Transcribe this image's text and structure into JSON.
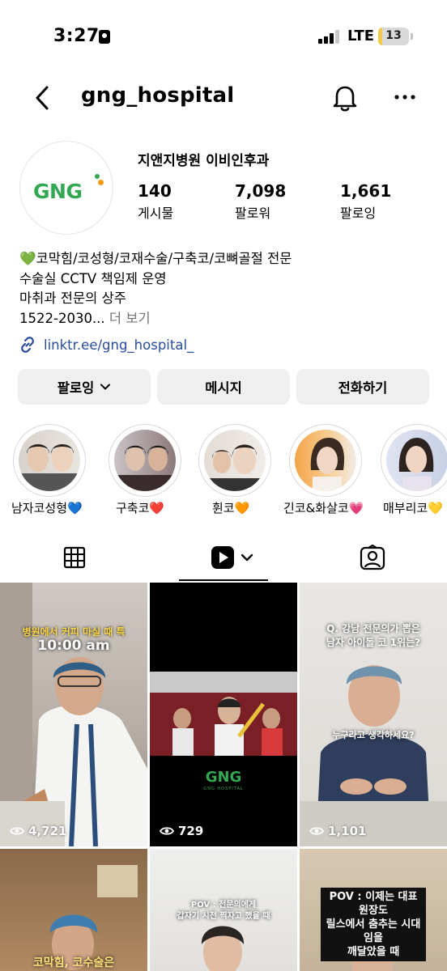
{
  "status_bar": {
    "time": "3:27",
    "network": "LTE",
    "battery": "13",
    "battery_level": 0.13
  },
  "header": {
    "username": "gng_hospital"
  },
  "profile": {
    "avatar_logo": "GNG",
    "display_name": "지앤지병원 이비인후과",
    "stats": [
      {
        "value": "140",
        "label": "게시물"
      },
      {
        "value": "7,098",
        "label": "팔로워"
      },
      {
        "value": "1,661",
        "label": "팔로잉"
      }
    ],
    "bio": [
      "💚코막힘/코성형/코재수술/구축코/코뼈골절 전문",
      "수술실 CCTV 책임제 운영",
      "마취과 전문의 상주"
    ],
    "bio_truncated": "1522-2030...",
    "bio_more": " 더 보기",
    "link": "linktr.ee/gng_hospital_"
  },
  "buttons": {
    "follow": "팔로잉",
    "message": "메시지",
    "call": "전화하기"
  },
  "highlights": [
    {
      "label": "남자코성형💙"
    },
    {
      "label": "구축코❤️"
    },
    {
      "label": "휜코🧡"
    },
    {
      "label": "긴코&화살코💗"
    },
    {
      "label": "매부리코💛"
    }
  ],
  "tabs": [
    "grid",
    "reels",
    "tagged"
  ],
  "reels": [
    {
      "views": "4,721",
      "caption_top": "병원에서 커피 마실 때 특",
      "caption_main": "10:00 am"
    },
    {
      "views": "729",
      "logo": "GNG",
      "logo_sub": "GNG HOSPITAL"
    },
    {
      "views": "1,101",
      "caption_top": "Q. 강남 전문의가 뽑은",
      "caption_top2": "남자 아이돌 코 1위는?",
      "caption_mid": "누구라고 생각하세요?"
    },
    {
      "caption_bottom": "코막힘, 코수술은"
    },
    {
      "caption_top": "POV : 전문의에게",
      "caption_top2": "갑자기 시전 찍자고 했을 때"
    },
    {
      "caption_box1": "POV : 이제는 대표원장도",
      "caption_box2": "릴스에서 춤추는 시대임을",
      "caption_box3": "깨달았을 때"
    }
  ]
}
